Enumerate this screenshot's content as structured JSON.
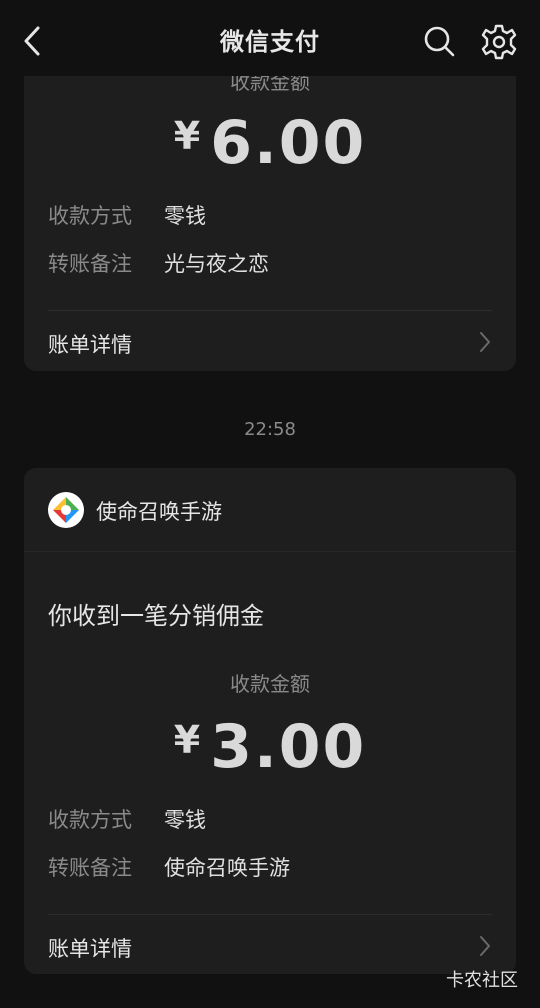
{
  "navbar": {
    "title": "微信支付",
    "back_icon": "chevron-left-icon",
    "search_icon": "search-icon",
    "settings_icon": "gear-icon"
  },
  "card1": {
    "amount_label": "收款金额",
    "currency": "¥",
    "amount": "6.00",
    "rows": [
      {
        "key": "收款方式",
        "value": "零钱"
      },
      {
        "key": "转账备注",
        "value": "光与夜之恋"
      }
    ],
    "detail_label": "账单详情"
  },
  "timestamp": "22:58",
  "card2": {
    "app_name": "使命召唤手游",
    "message_title": "你收到一笔分销佣金",
    "amount_label": "收款金额",
    "currency": "¥",
    "amount": "3.00",
    "rows": [
      {
        "key": "收款方式",
        "value": "零钱"
      },
      {
        "key": "转账备注",
        "value": "使命召唤手游"
      }
    ],
    "detail_label": "账单详情"
  },
  "watermark": "卡农社区",
  "colors": {
    "background": "#111111",
    "card": "#1e1e1e",
    "muted_text": "#8a8a8a",
    "primary_text": "#e6e6e6"
  }
}
